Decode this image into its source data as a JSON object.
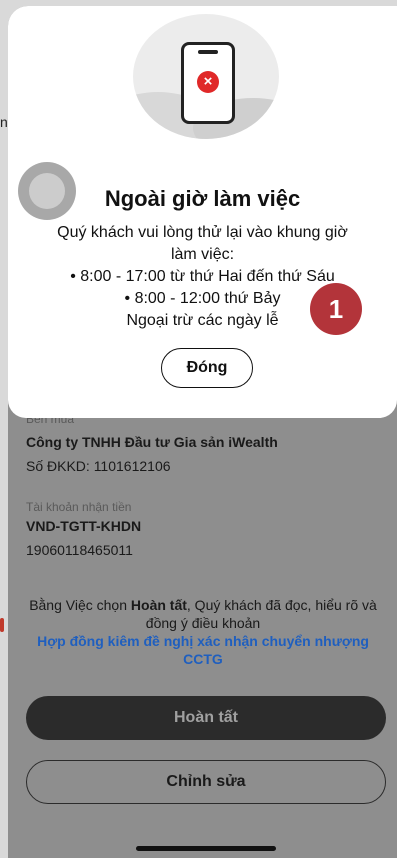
{
  "left_edge_text": "n",
  "background": {
    "buyer_label": "Bên mua",
    "buyer_name": "Công ty TNHH Đầu tư Gia sản iWealth",
    "business_reg": "Số ĐKKD: 1101612106",
    "account_label": "Tài khoản nhận tiền",
    "account_name": "VND-TGTT-KHDN",
    "account_number": "19060118465011",
    "terms_prefix": "Bằng Việc chọn ",
    "terms_bold": "Hoàn tất",
    "terms_suffix": ", Quý khách đã đọc, hiểu rõ và đồng ý điều khoản",
    "terms_link": "Hợp đồng kiêm đề nghị xác nhận chuyển nhượng CCTG",
    "complete_button": "Hoàn tất",
    "edit_button": "Chỉnh sửa"
  },
  "modal": {
    "title": "Ngoài giờ làm việc",
    "body_lines": [
      "Quý khách vui lòng thử lại vào khung giờ",
      "làm việc:",
      "• 8:00 - 17:00 từ thứ Hai đến thứ Sáu",
      "• 8:00 - 12:00 thứ Bảy",
      "Ngoại trừ các ngày lễ"
    ],
    "close_button": "Đóng",
    "error_glyph": "×"
  },
  "annotation_badge": "1",
  "colors": {
    "badge": "#b3343a",
    "error": "#e02828",
    "link": "#1f5fbf",
    "primary_button": "#2b2b2b"
  }
}
